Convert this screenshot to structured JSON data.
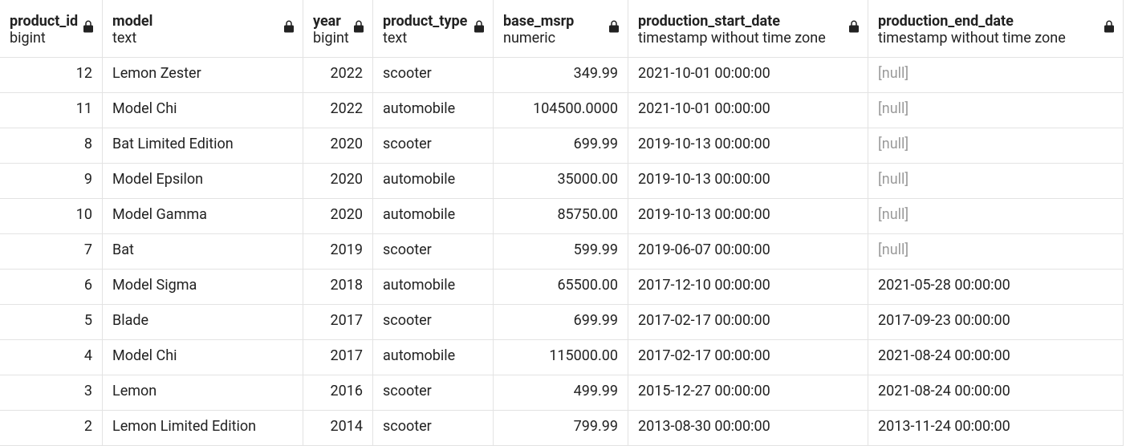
{
  "columns": [
    {
      "name": "product_id",
      "type": "bigint",
      "align": "num",
      "locked": true
    },
    {
      "name": "model",
      "type": "text",
      "align": "",
      "locked": true
    },
    {
      "name": "year",
      "type": "bigint",
      "align": "num",
      "locked": true
    },
    {
      "name": "product_type",
      "type": "text",
      "align": "",
      "locked": true
    },
    {
      "name": "base_msrp",
      "type": "numeric",
      "align": "num",
      "locked": true
    },
    {
      "name": "production_start_date",
      "type": "timestamp without time zone",
      "align": "",
      "locked": true
    },
    {
      "name": "production_end_date",
      "type": "timestamp without time zone",
      "align": "",
      "locked": true
    }
  ],
  "rows": [
    {
      "product_id": "12",
      "model": "Lemon Zester",
      "year": "2022",
      "product_type": "scooter",
      "base_msrp": "349.99",
      "production_start_date": "2021-10-01 00:00:00",
      "production_end_date": null
    },
    {
      "product_id": "11",
      "model": "Model Chi",
      "year": "2022",
      "product_type": "automobile",
      "base_msrp": "104500.0000",
      "production_start_date": "2021-10-01 00:00:00",
      "production_end_date": null
    },
    {
      "product_id": "8",
      "model": "Bat Limited Edition",
      "year": "2020",
      "product_type": "scooter",
      "base_msrp": "699.99",
      "production_start_date": "2019-10-13 00:00:00",
      "production_end_date": null
    },
    {
      "product_id": "9",
      "model": "Model Epsilon",
      "year": "2020",
      "product_type": "automobile",
      "base_msrp": "35000.00",
      "production_start_date": "2019-10-13 00:00:00",
      "production_end_date": null
    },
    {
      "product_id": "10",
      "model": "Model Gamma",
      "year": "2020",
      "product_type": "automobile",
      "base_msrp": "85750.00",
      "production_start_date": "2019-10-13 00:00:00",
      "production_end_date": null
    },
    {
      "product_id": "7",
      "model": "Bat",
      "year": "2019",
      "product_type": "scooter",
      "base_msrp": "599.99",
      "production_start_date": "2019-06-07 00:00:00",
      "production_end_date": null
    },
    {
      "product_id": "6",
      "model": "Model Sigma",
      "year": "2018",
      "product_type": "automobile",
      "base_msrp": "65500.00",
      "production_start_date": "2017-12-10 00:00:00",
      "production_end_date": "2021-05-28 00:00:00"
    },
    {
      "product_id": "5",
      "model": "Blade",
      "year": "2017",
      "product_type": "scooter",
      "base_msrp": "699.99",
      "production_start_date": "2017-02-17 00:00:00",
      "production_end_date": "2017-09-23 00:00:00"
    },
    {
      "product_id": "4",
      "model": "Model Chi",
      "year": "2017",
      "product_type": "automobile",
      "base_msrp": "115000.00",
      "production_start_date": "2017-02-17 00:00:00",
      "production_end_date": "2021-08-24 00:00:00"
    },
    {
      "product_id": "3",
      "model": "Lemon",
      "year": "2016",
      "product_type": "scooter",
      "base_msrp": "499.99",
      "production_start_date": "2015-12-27 00:00:00",
      "production_end_date": "2021-08-24 00:00:00"
    },
    {
      "product_id": "2",
      "model": "Lemon Limited Edition",
      "year": "2014",
      "product_type": "scooter",
      "base_msrp": "799.99",
      "production_start_date": "2013-08-30 00:00:00",
      "production_end_date": "2013-11-24 00:00:00"
    }
  ],
  "null_display": "[null]"
}
